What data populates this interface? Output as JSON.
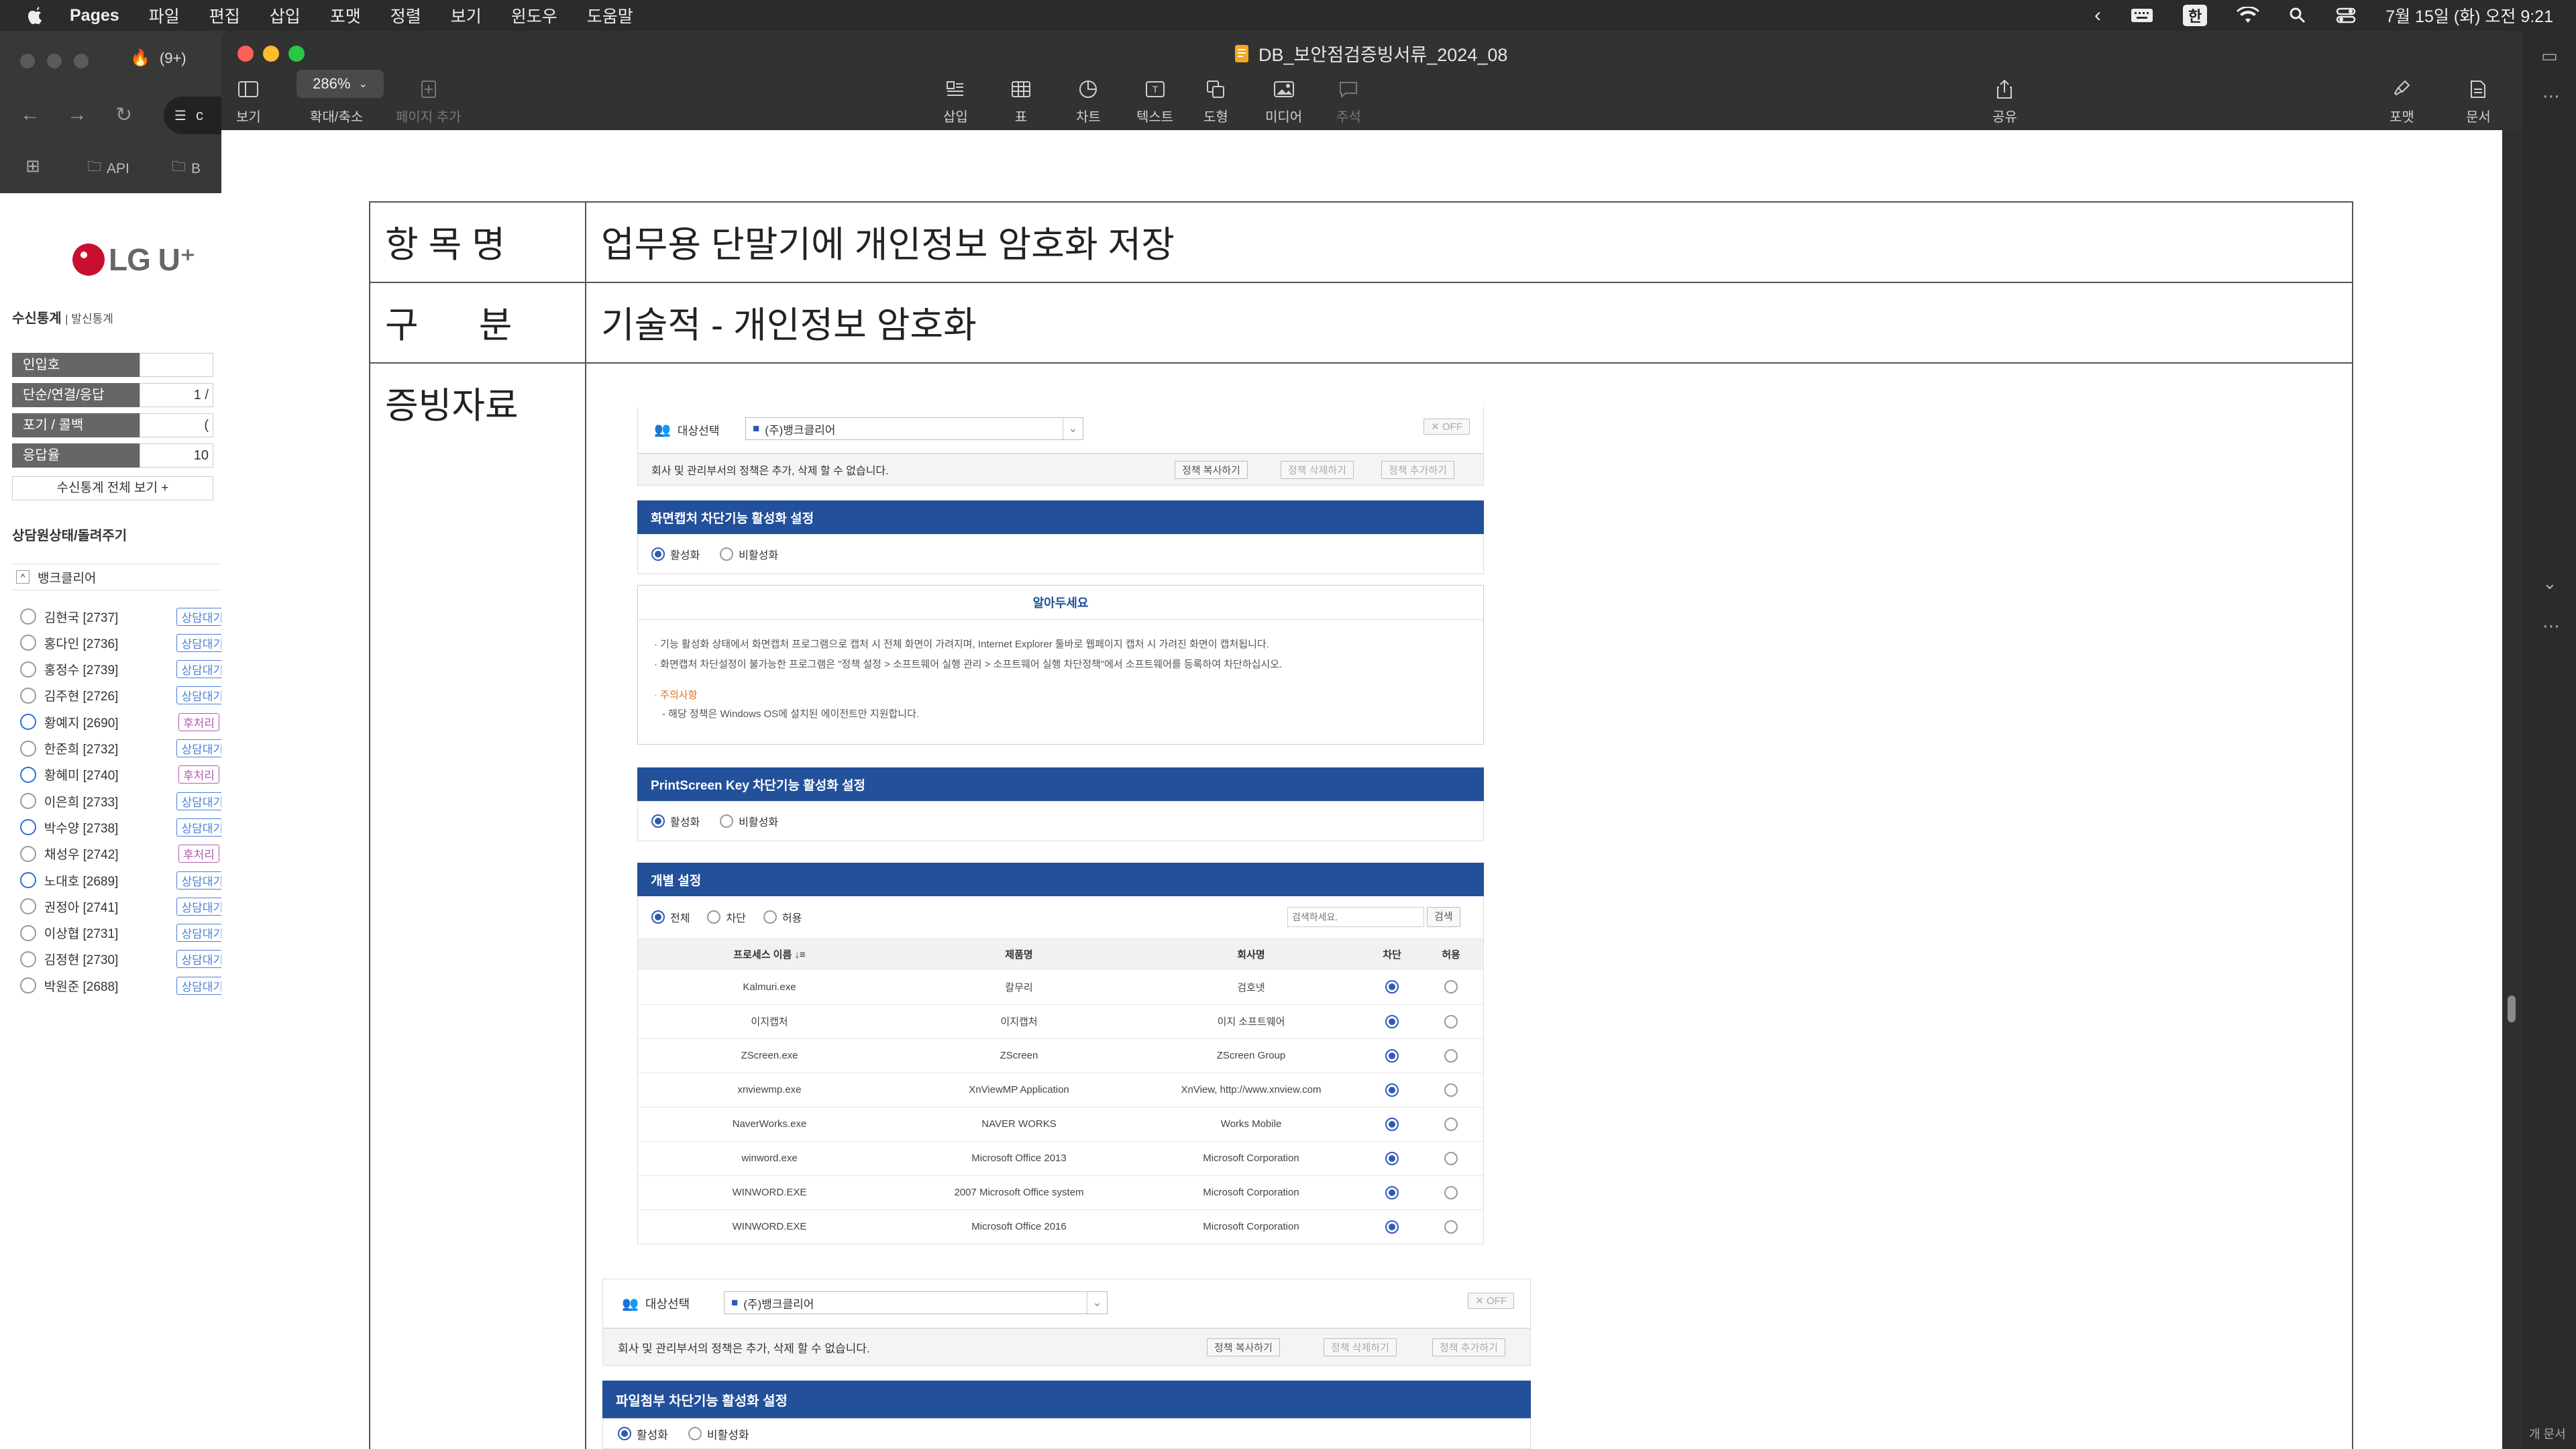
{
  "menubar": {
    "app": "Pages",
    "items": [
      "파일",
      "편집",
      "삽입",
      "포맷",
      "정렬",
      "보기",
      "윈도우",
      "도움말"
    ],
    "ime": "한",
    "datetime": "7월 15일 (화) 오전 9:21"
  },
  "browser": {
    "tab_label": "(9+)",
    "bookmark_api": "API",
    "bookmark_b": "B",
    "addr_char": "c",
    "logo_text": "LG U⁺",
    "stats_title": "수신통계",
    "stats_subtitle": "| 발신통계",
    "stats": [
      {
        "label": "인입호",
        "value": ""
      },
      {
        "label": "단순/연결/응답",
        "value": "1 /"
      },
      {
        "label": "포기 / 콜백",
        "value": "("
      },
      {
        "label": "응답율",
        "value": "10"
      }
    ],
    "view_all": "수신통계 전체 보기 +",
    "agent_section": "상담원상태/돌려주기",
    "group": "뱅크클리어",
    "agents": [
      {
        "name": "김현국 [2737]",
        "status": "상담대기",
        "kind": "wait",
        "avatar": "gray"
      },
      {
        "name": "홍다인 [2736]",
        "status": "상담대기",
        "kind": "wait",
        "avatar": "gray"
      },
      {
        "name": "홍정수 [2739]",
        "status": "상담대기",
        "kind": "wait",
        "avatar": "gray"
      },
      {
        "name": "김주현 [2726]",
        "status": "상담대기",
        "kind": "wait",
        "avatar": "gray"
      },
      {
        "name": "황예지 [2690]",
        "status": "후처리",
        "kind": "post",
        "avatar": "blue"
      },
      {
        "name": "한준희 [2732]",
        "status": "상담대기",
        "kind": "wait",
        "avatar": "gray"
      },
      {
        "name": "황혜미 [2740]",
        "status": "후처리",
        "kind": "post",
        "avatar": "blue"
      },
      {
        "name": "이은희 [2733]",
        "status": "상담대기",
        "kind": "wait",
        "avatar": "gray"
      },
      {
        "name": "박수양 [2738]",
        "status": "상담대기",
        "kind": "wait",
        "avatar": "blue"
      },
      {
        "name": "채성우 [2742]",
        "status": "후처리",
        "kind": "post",
        "avatar": "gray"
      },
      {
        "name": "노대호 [2689]",
        "status": "상담대기",
        "kind": "wait",
        "avatar": "blue"
      },
      {
        "name": "권정아 [2741]",
        "status": "상담대기",
        "kind": "wait",
        "avatar": "gray"
      },
      {
        "name": "이상협 [2731]",
        "status": "상담대기",
        "kind": "wait",
        "avatar": "gray"
      },
      {
        "name": "김정현 [2730]",
        "status": "상담대기",
        "kind": "wait",
        "avatar": "gray"
      },
      {
        "name": "박원준 [2688]",
        "status": "상담대기",
        "kind": "wait",
        "avatar": "gray"
      }
    ]
  },
  "pages": {
    "doc_title": "DB_보안점검증빙서류_2024_08",
    "zoom": "286%",
    "toolbar": {
      "view": "보기",
      "zoom": "확대/축소",
      "add_page": "페이지 추가",
      "insert": "삽입",
      "table": "표",
      "chart": "차트",
      "text": "텍스트",
      "shape": "도형",
      "media": "미디어",
      "comment": "주석",
      "share": "공유",
      "format": "포맷",
      "document": "문서"
    },
    "inspector_label": "개 문서"
  },
  "doc": {
    "rows": [
      {
        "label": "항 목 명",
        "value": "업무용 단말기에 개인정보 암호화 저장"
      },
      {
        "label": "구      분",
        "value": "기술적 - 개인정보 암호화"
      },
      {
        "label": "증빙자료",
        "value": ""
      }
    ]
  },
  "shot1": {
    "target_label": "대상선택",
    "target_value": "(주)뱅크클리어",
    "off": "OFF",
    "note": "회사 및 관리부서의 정책은 추가, 삭제 할 수 없습니다.",
    "copy_btn": "정책 복사하기",
    "del_btn": "정책 삭제하기",
    "add_btn": "정책 추가하기",
    "capture_title": "화면캡처 차단기능 활성화 설정",
    "on": "활성화",
    "off_opt": "비활성화",
    "notice_title": "알아두세요",
    "notice_lines": [
      "· 기능 활성화 상태에서 화면캡처 프로그램으로 캡처 시 전체 화면이 가려지며, Internet Explorer 툴바로 웹페이지 캡처 시 가려진 화면이 캡처됩니다.",
      "· 화면캡처 차단설정이 불가능한 프로그램은 \"정책 설정 > 소프트웨어 실행 관리 > 소프트웨어 실행 차단정책\"에서 소프트웨어를 등록하여 차단하십시오."
    ],
    "caution_title": "· 주의사항",
    "caution_line": "- 해당 정책은 Windows OS에 설치된 에이전트만 지원합니다.",
    "prtsc_title": "PrintScreen Key 차단기능 활성화 설정",
    "individual_title": "개별 설정",
    "filter_all": "전체",
    "filter_block": "차단",
    "filter_allow": "허용",
    "search_placeholder": "검색하세요.",
    "search_btn": "검색",
    "columns": [
      "프로세스 이름 ↓≡",
      "제품명",
      "회사명",
      "차단",
      "허용"
    ],
    "rows": [
      {
        "proc": "Kalmuri.exe",
        "product": "칼무리",
        "company": "검호넷"
      },
      {
        "proc": "이지캡처",
        "product": "이지캡처",
        "company": "이지 소프트웨어"
      },
      {
        "proc": "ZScreen.exe",
        "product": "ZScreen",
        "company": "ZScreen Group"
      },
      {
        "proc": "xnviewmp.exe",
        "product": "XnViewMP Application",
        "company": "XnView, http://www.xnview.com"
      },
      {
        "proc": "NaverWorks.exe",
        "product": "NAVER WORKS",
        "company": "Works Mobile"
      },
      {
        "proc": "winword.exe",
        "product": "Microsoft Office 2013",
        "company": "Microsoft Corporation"
      },
      {
        "proc": "WINWORD.EXE",
        "product": "2007 Microsoft Office system",
        "company": "Microsoft Corporation"
      },
      {
        "proc": "WINWORD.EXE",
        "product": "Microsoft Office 2016",
        "company": "Microsoft Corporation"
      }
    ]
  },
  "shot2": {
    "target_label": "대상선택",
    "target_value": "(주)뱅크클리어",
    "off": "OFF",
    "note": "회사 및 관리부서의 정책은 추가, 삭제 할 수 없습니다.",
    "copy_btn": "정책 복사하기",
    "del_btn": "정책 삭제하기",
    "add_btn": "정책 추가하기",
    "file_title": "파일첨부 차단기능 활성화 설정",
    "on": "활성화",
    "off_opt": "비활성화"
  },
  "colors": {
    "accent": "#22509a",
    "lg_red": "#c8102e",
    "wait": "#4a7fd8",
    "post": "#b05ab0"
  }
}
